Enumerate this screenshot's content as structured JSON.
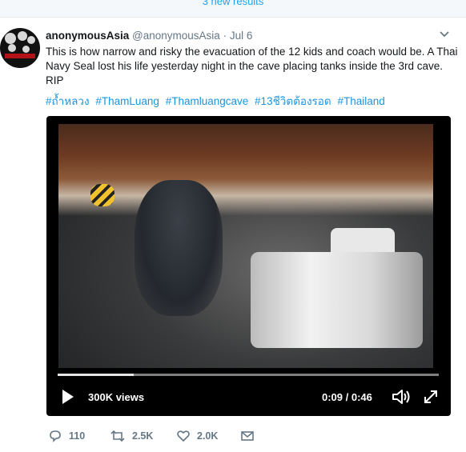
{
  "new_results": "3 new results",
  "tweet": {
    "author_name": "anonymousAsia",
    "handle": "@anonymousAsia",
    "separator": "·",
    "time": "Jul 6",
    "text": "This is how narrow and risky the evacuation of the 12 kids and coach would be. A Thai Navy Seal lost his life yesterday night in the cave placing tanks inside the 3rd cave. RIP",
    "hashtags": [
      "#ถ้ำหลวง",
      "#ThamLuang",
      "#Thamluangcave",
      "#13ชีวิตต้องรอด",
      "#Thailand"
    ]
  },
  "video": {
    "views": "300K views",
    "time": "0:09 / 0:46",
    "progress_fraction": 0.2
  },
  "actions": {
    "reply_count": "110",
    "retweet_count": "2.5K",
    "like_count": "2.0K"
  },
  "icons": {
    "reply": "reply-icon",
    "retweet": "retweet-icon",
    "like": "heart-icon",
    "dm": "envelope-icon",
    "caret": "chevron-down-icon",
    "play": "play-icon",
    "volume": "volume-icon",
    "fullscreen": "fullscreen-icon"
  },
  "colors": {
    "link": "#1b95e0",
    "muted": "#657786",
    "text": "#14171a"
  }
}
